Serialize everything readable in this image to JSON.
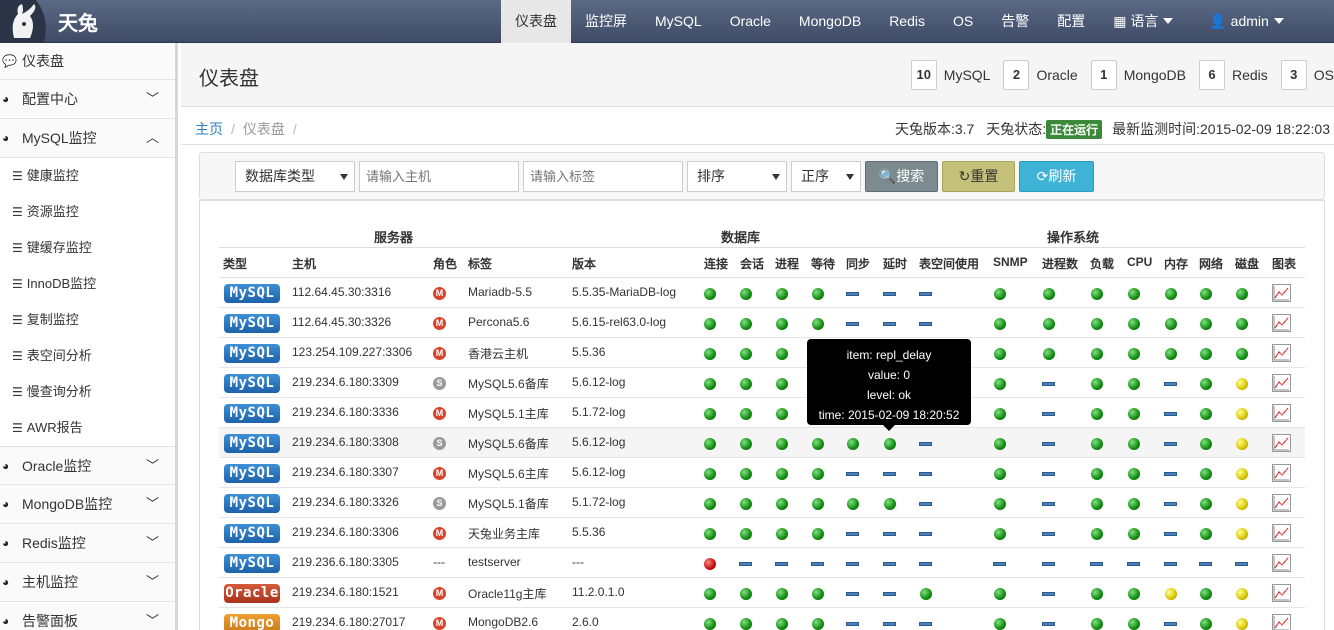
{
  "brand": {
    "name": "天兔"
  },
  "nav": {
    "items": [
      "仪表盘",
      "监控屏",
      "MySQL",
      "Oracle",
      "MongoDB",
      "Redis",
      "OS",
      "告警",
      "配置"
    ],
    "language": "语言",
    "user": "admin"
  },
  "sidebar": {
    "dashboard": "仪表盘",
    "config": "配置中心",
    "mysql": "MySQL监控",
    "mysql_subs": [
      "健康监控",
      "资源监控",
      "键缓存监控",
      "InnoDB监控",
      "复制监控",
      "表空间分析",
      "慢查询分析",
      "AWR报告"
    ],
    "oracle": "Oracle监控",
    "mongodb": "MongoDB监控",
    "redis": "Redis监控",
    "host": "主机监控",
    "alarm": "告警面板"
  },
  "header": {
    "title": "仪表盘",
    "counts": [
      {
        "num": "10",
        "label": "MySQL"
      },
      {
        "num": "2",
        "label": "Oracle"
      },
      {
        "num": "1",
        "label": "MongoDB"
      },
      {
        "num": "6",
        "label": "Redis"
      },
      {
        "num": "3",
        "label": "OS"
      }
    ]
  },
  "breadcrumb": {
    "home": "主页",
    "current": "仪表盘",
    "sep": "/"
  },
  "status": {
    "version_label": "天兔版本:3.7",
    "state_label": "天兔状态:",
    "state_value": "正在运行",
    "last_time": "最新监测时间:2015-02-09 18:22:03"
  },
  "filter": {
    "db_type": "数据库类型",
    "host_placeholder": "请输入主机",
    "tag_placeholder": "请输入标签",
    "sort": "排序",
    "order": "正序",
    "search": "搜索",
    "reset": "重置",
    "refresh": "刷新"
  },
  "table": {
    "groups": {
      "server": "服务器",
      "database": "数据库",
      "os": "操作系统"
    },
    "headers": [
      "类型",
      "主机",
      "角色",
      "标签",
      "版本",
      "连接",
      "会话",
      "进程",
      "等待",
      "同步",
      "延时",
      "表空间使用",
      "SNMP",
      "进程数",
      "负载",
      "CPU",
      "内存",
      "网络",
      "磁盘",
      "图表"
    ],
    "rows": [
      {
        "type": "MySQL",
        "host": "112.64.45.30:3316",
        "role": "M",
        "tag": "Mariadb-5.5",
        "version": "5.5.35-MariaDB-log",
        "st": [
          "ok",
          "ok",
          "ok",
          "ok",
          "dash",
          "dash",
          "dash",
          "ok",
          "ok",
          "ok",
          "ok",
          "ok",
          "ok",
          "ok"
        ]
      },
      {
        "type": "MySQL",
        "host": "112.64.45.30:3326",
        "role": "M",
        "tag": "Percona5.6",
        "version": "5.6.15-rel63.0-log",
        "st": [
          "ok",
          "ok",
          "ok",
          "ok",
          "dash",
          "dash",
          "dash",
          "ok",
          "ok",
          "ok",
          "ok",
          "ok",
          "ok",
          "ok"
        ]
      },
      {
        "type": "MySQL",
        "host": "123.254.109.227:3306",
        "role": "M",
        "tag": "香港云主机",
        "version": "5.5.36",
        "st": [
          "ok",
          "ok",
          "ok",
          "ok",
          "ok",
          "ok",
          "dash",
          "ok",
          "ok",
          "ok",
          "ok",
          "ok",
          "ok",
          "ok"
        ]
      },
      {
        "type": "MySQL",
        "host": "219.234.6.180:3309",
        "role": "S",
        "tag": "MySQL5.6备库",
        "version": "5.6.12-log",
        "st": [
          "ok",
          "ok",
          "ok",
          "ok",
          "ok",
          "ok",
          "dash",
          "ok",
          "dash",
          "ok",
          "ok",
          "dash",
          "ok",
          "warn"
        ]
      },
      {
        "type": "MySQL",
        "host": "219.234.6.180:3336",
        "role": "M",
        "tag": "MySQL5.1主库",
        "version": "5.1.72-log",
        "st": [
          "ok",
          "ok",
          "ok",
          "ok",
          "ok",
          "ok",
          "dash",
          "ok",
          "dash",
          "ok",
          "ok",
          "dash",
          "ok",
          "warn"
        ]
      },
      {
        "type": "MySQL",
        "host": "219.234.6.180:3308",
        "role": "S",
        "tag": "MySQL5.6备库",
        "version": "5.6.12-log",
        "st": [
          "ok",
          "ok",
          "ok",
          "ok",
          "ok",
          "ok",
          "dash",
          "ok",
          "dash",
          "ok",
          "ok",
          "dash",
          "ok",
          "warn"
        ]
      },
      {
        "type": "MySQL",
        "host": "219.234.6.180:3307",
        "role": "M",
        "tag": "MySQL5.6主库",
        "version": "5.6.12-log",
        "st": [
          "ok",
          "ok",
          "ok",
          "ok",
          "dash",
          "dash",
          "dash",
          "ok",
          "dash",
          "ok",
          "ok",
          "dash",
          "ok",
          "warn"
        ]
      },
      {
        "type": "MySQL",
        "host": "219.234.6.180:3326",
        "role": "S",
        "tag": "MySQL5.1备库",
        "version": "5.1.72-log",
        "st": [
          "ok",
          "ok",
          "ok",
          "ok",
          "ok",
          "ok",
          "dash",
          "ok",
          "dash",
          "ok",
          "ok",
          "dash",
          "ok",
          "warn"
        ]
      },
      {
        "type": "MySQL",
        "host": "219.234.6.180:3306",
        "role": "M",
        "tag": "天兔业务主库",
        "version": "5.5.36",
        "st": [
          "ok",
          "ok",
          "ok",
          "ok",
          "dash",
          "dash",
          "dash",
          "ok",
          "dash",
          "ok",
          "ok",
          "dash",
          "ok",
          "warn"
        ]
      },
      {
        "type": "MySQL",
        "host": "219.236.6.180:3305",
        "role": "---",
        "tag": "testserver",
        "version": "---",
        "st": [
          "err",
          "dash",
          "dash",
          "dash",
          "dash",
          "dash",
          "dash",
          "dash",
          "dash",
          "dash",
          "dash",
          "dash",
          "dash",
          "dash"
        ]
      },
      {
        "type": "Oracle",
        "host": "219.234.6.180:1521",
        "role": "M",
        "tag": "Oracle11g主库",
        "version": "11.2.0.1.0",
        "st": [
          "ok",
          "ok",
          "ok",
          "ok",
          "dash",
          "dash",
          "ok",
          "ok",
          "dash",
          "ok",
          "ok",
          "warn",
          "ok",
          "warn"
        ]
      },
      {
        "type": "Mongo",
        "host": "219.234.6.180:27017",
        "role": "M",
        "tag": "MongoDB2.6",
        "version": "2.6.0",
        "st": [
          "ok",
          "ok",
          "ok",
          "ok",
          "dash",
          "dash",
          "dash",
          "ok",
          "dash",
          "ok",
          "ok",
          "dash",
          "ok",
          "warn"
        ]
      }
    ]
  },
  "tooltip": {
    "item": "item: repl_delay",
    "value": "value: 0",
    "level": "level: ok",
    "time": "time: 2015-02-09 18:20:52"
  }
}
